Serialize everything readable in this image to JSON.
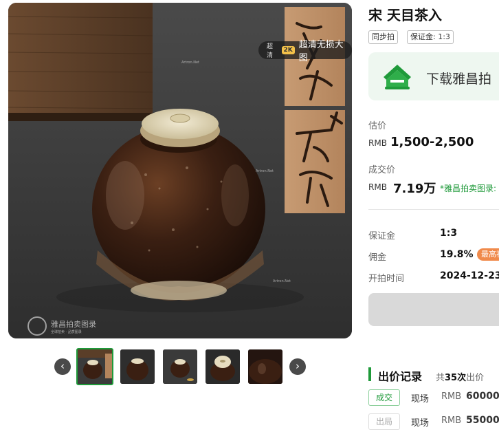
{
  "gallery": {
    "hd_badge": {
      "small": "超清",
      "res": "2K",
      "label": "超清无损大图"
    },
    "watermark_text": "Artron.Net",
    "brand": {
      "name": "雅昌拍卖图录",
      "sub": "全球拍卖 · 品质图录"
    },
    "prev_icon": "chevron-left-icon",
    "next_icon": "chevron-right-icon",
    "thumbnails": 5,
    "active_thumbnail": 1
  },
  "lot": {
    "title": "宋 天目茶入",
    "tags": [
      "同步拍",
      "保证金: 1:3"
    ]
  },
  "app_banner": {
    "text": "下载雅昌拍"
  },
  "pricing": {
    "estimate_label": "估价",
    "estimate_currency": "RMB",
    "estimate_value": "1,500-2,500",
    "sold_label": "成交价",
    "sold_currency": "RMB",
    "sold_value": "7.19万",
    "sold_note": "*雅昌拍卖图录:"
  },
  "info": {
    "deposit_label": "保证金",
    "deposit_value": "1:3",
    "commission_label": "佣金",
    "commission_value": "19.8%",
    "commission_pill": "最高补",
    "start_label": "开拍时间",
    "start_value": "2024-12-23"
  },
  "bids": {
    "title": "出价记录",
    "count_prefix": "共",
    "count": "35次",
    "count_suffix": "出价",
    "rows": [
      {
        "status": "成交",
        "type": "现场",
        "currency": "RMB",
        "amount": "60000"
      },
      {
        "status": "出局",
        "type": "现场",
        "currency": "RMB",
        "amount": "55000"
      }
    ]
  },
  "colors": {
    "accent": "#1f9a3a",
    "pill": "#f08a4b"
  }
}
